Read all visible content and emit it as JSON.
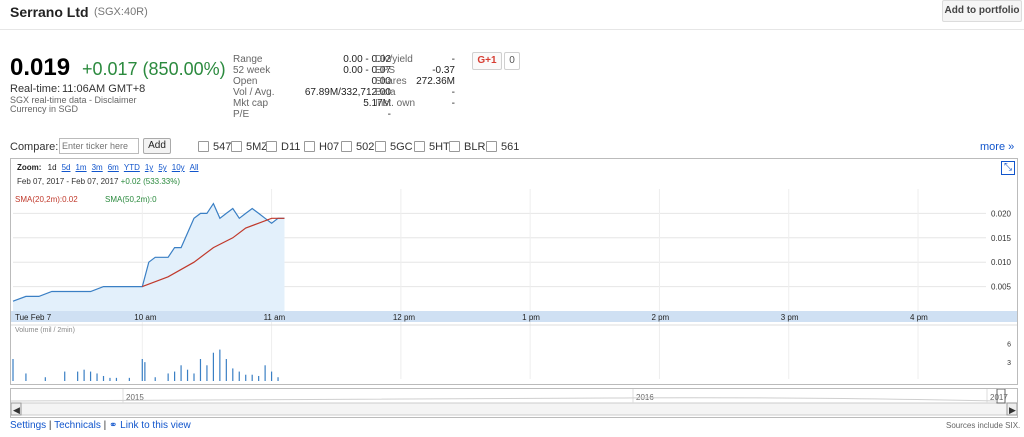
{
  "header": {
    "company": "Serrano Ltd",
    "ticker": "(SGX:40R)",
    "add_portfolio": "Add to portfolio"
  },
  "quote": {
    "price": "0.019",
    "change": "+0.017 (850.00%)",
    "realtime_label": "Real-time:",
    "realtime_time": "11:06AM GMT+8",
    "disclaimer": "SGX real-time data - Disclaimer",
    "currency": "Currency in SGD"
  },
  "stats_left": [
    {
      "label": "Range",
      "value": "0.00 - 0.02"
    },
    {
      "label": "52 week",
      "value": "0.00 - 0.07"
    },
    {
      "label": "Open",
      "value": "0.00"
    },
    {
      "label": "Vol / Avg.",
      "value": "67.89M/332,712.00"
    },
    {
      "label": "Mkt cap",
      "value": "5.17M"
    },
    {
      "label": "P/E",
      "value": "-"
    }
  ],
  "stats_right": [
    {
      "label": "Div/yield",
      "value": "-"
    },
    {
      "label": "EPS",
      "value": "-0.37"
    },
    {
      "label": "Shares",
      "value": "272.36M"
    },
    {
      "label": "Beta",
      "value": "-"
    },
    {
      "label": "Inst. own",
      "value": "-"
    }
  ],
  "social": {
    "gplus": "G+1",
    "count": "0"
  },
  "compare": {
    "label": "Compare:",
    "placeholder": "Enter ticker here",
    "add": "Add",
    "tickers": [
      "547",
      "5MZ",
      "D11",
      "H07",
      "502",
      "5GC",
      "5HT",
      "BLR",
      "561"
    ],
    "more": "more »"
  },
  "chart": {
    "zoom_label": "Zoom:",
    "zoom_options": [
      "1d",
      "5d",
      "1m",
      "3m",
      "6m",
      "YTD",
      "1y",
      "5y",
      "10y",
      "All"
    ],
    "range_text": "Feb 07, 2017 - Feb 07, 2017",
    "range_change": "+0.02 (533.33%)",
    "sma1": "SMA(20,2m):0.02",
    "sma2": "SMA(50,2m):0",
    "volume_label": "Volume (mil / 2min)",
    "colors": {
      "price": "#3a7fc4",
      "fill": "#e3f0fb",
      "sma": "#c0392b",
      "volume": "#3a7fc4",
      "axis_band": "#cfe0f3"
    }
  },
  "chart_data": {
    "type": "area",
    "x_tick_labels": [
      "Tue Feb 7",
      "10 am",
      "11 am",
      "12 pm",
      "1 pm",
      "2 pm",
      "3 pm",
      "4 pm"
    ],
    "y_tick_labels": [
      "0.005",
      "0.010",
      "0.015",
      "0.020"
    ],
    "ylim": [
      0,
      0.025
    ],
    "volume_ticks": [
      "3",
      "6"
    ],
    "series": [
      {
        "name": "",
        "x_hours": [
          9.0,
          9.1,
          9.2,
          9.3,
          9.5,
          9.6,
          9.7,
          9.8,
          9.9,
          10.0,
          10.05,
          10.1,
          10.2,
          10.25,
          10.3,
          10.4,
          10.45,
          10.5,
          10.55,
          10.6,
          10.65,
          10.7,
          10.75,
          10.8,
          10.85,
          10.9,
          10.95,
          11.0,
          11.05,
          11.1
        ],
        "values": [
          0.002,
          0.003,
          0.003,
          0.004,
          0.004,
          0.004,
          0.005,
          0.005,
          0.005,
          0.005,
          0.01,
          0.011,
          0.011,
          0.013,
          0.013,
          0.019,
          0.02,
          0.02,
          0.022,
          0.019,
          0.02,
          0.021,
          0.019,
          0.02,
          0.021,
          0.02,
          0.019,
          0.018,
          0.019,
          0.019
        ]
      },
      {
        "name": "SMA(20,2m)",
        "x_hours": [
          10.0,
          10.2,
          10.4,
          10.55,
          10.7,
          10.8,
          10.9,
          11.0,
          11.1
        ],
        "values": [
          0.005,
          0.007,
          0.01,
          0.013,
          0.015,
          0.017,
          0.018,
          0.019,
          0.019
        ]
      }
    ],
    "volume": {
      "x_hours": [
        9.0,
        9.1,
        9.25,
        9.4,
        9.5,
        9.55,
        9.6,
        9.65,
        9.7,
        9.75,
        9.8,
        9.9,
        10.0,
        10.02,
        10.1,
        10.2,
        10.25,
        10.3,
        10.35,
        10.4,
        10.45,
        10.5,
        10.55,
        10.6,
        10.65,
        10.7,
        10.75,
        10.8,
        10.85,
        10.9,
        10.95,
        11.0,
        11.05
      ],
      "values": [
        3.5,
        1.2,
        0.6,
        1.5,
        1.5,
        1.8,
        1.5,
        1.2,
        0.8,
        0.5,
        0.5,
        0.5,
        3.5,
        3.0,
        0.6,
        1.2,
        1.5,
        2.5,
        1.8,
        1.2,
        3.5,
        2.5,
        4.5,
        5.0,
        3.5,
        2.0,
        1.5,
        1.0,
        1.0,
        0.8,
        2.5,
        1.5,
        0.6
      ]
    },
    "navigator_labels": [
      "2015",
      "2016",
      "2017"
    ]
  },
  "footer": {
    "settings": "Settings",
    "technicals": "Technicals",
    "link_view": "Link to this view",
    "sources": "Sources include SIX."
  }
}
